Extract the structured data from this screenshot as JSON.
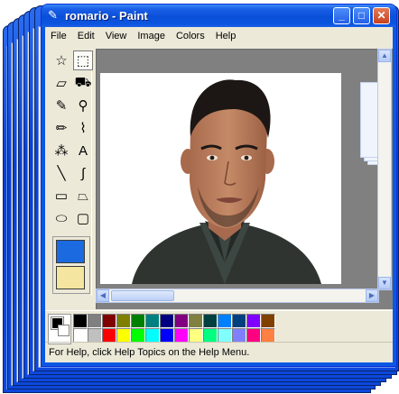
{
  "window": {
    "title": "romario - Paint"
  },
  "title_buttons": {
    "minimize": "_",
    "maximize": "□",
    "close": "✕"
  },
  "menu": [
    "File",
    "Edit",
    "View",
    "Image",
    "Colors",
    "Help"
  ],
  "tools": [
    {
      "name": "free-select",
      "icon": "free-select-icon",
      "glyph": "☆"
    },
    {
      "name": "rect-select",
      "icon": "rect-select-icon",
      "glyph": "⬚",
      "selected": true
    },
    {
      "name": "eraser",
      "icon": "eraser-icon",
      "glyph": "▱"
    },
    {
      "name": "fill",
      "icon": "fill-bucket-icon",
      "glyph": "⛟"
    },
    {
      "name": "pick-color",
      "icon": "eyedropper-icon",
      "glyph": "✎"
    },
    {
      "name": "magnifier",
      "icon": "magnifier-icon",
      "glyph": "⚲"
    },
    {
      "name": "pencil",
      "icon": "pencil-icon",
      "glyph": "✏"
    },
    {
      "name": "brush",
      "icon": "brush-icon",
      "glyph": "⌇"
    },
    {
      "name": "airbrush",
      "icon": "airbrush-icon",
      "glyph": "⁂"
    },
    {
      "name": "text",
      "icon": "text-icon",
      "glyph": "A"
    },
    {
      "name": "line",
      "icon": "line-icon",
      "glyph": "╲"
    },
    {
      "name": "curve",
      "icon": "curve-icon",
      "glyph": "∫"
    },
    {
      "name": "rectangle",
      "icon": "rectangle-icon",
      "glyph": "▭"
    },
    {
      "name": "polygon",
      "icon": "polygon-icon",
      "glyph": "⏢"
    },
    {
      "name": "ellipse",
      "icon": "ellipse-icon",
      "glyph": "⬭"
    },
    {
      "name": "rounded-rect",
      "icon": "rounded-rect-icon",
      "glyph": "▢"
    }
  ],
  "palette": [
    "#000000",
    "#808080",
    "#800000",
    "#808000",
    "#008000",
    "#008080",
    "#000080",
    "#800080",
    "#808040",
    "#004040",
    "#0080ff",
    "#004080",
    "#8000ff",
    "#804000",
    "#ffffff",
    "#c0c0c0",
    "#ff0000",
    "#ffff00",
    "#00ff00",
    "#00ffff",
    "#0000ff",
    "#ff00ff",
    "#ffff80",
    "#00ff80",
    "#80ffff",
    "#8080ff",
    "#ff0080",
    "#ff8040"
  ],
  "colors": {
    "foreground": "#000000",
    "background": "#ffffff"
  },
  "status": {
    "text": "For Help, click Help Topics on the Help Menu."
  }
}
